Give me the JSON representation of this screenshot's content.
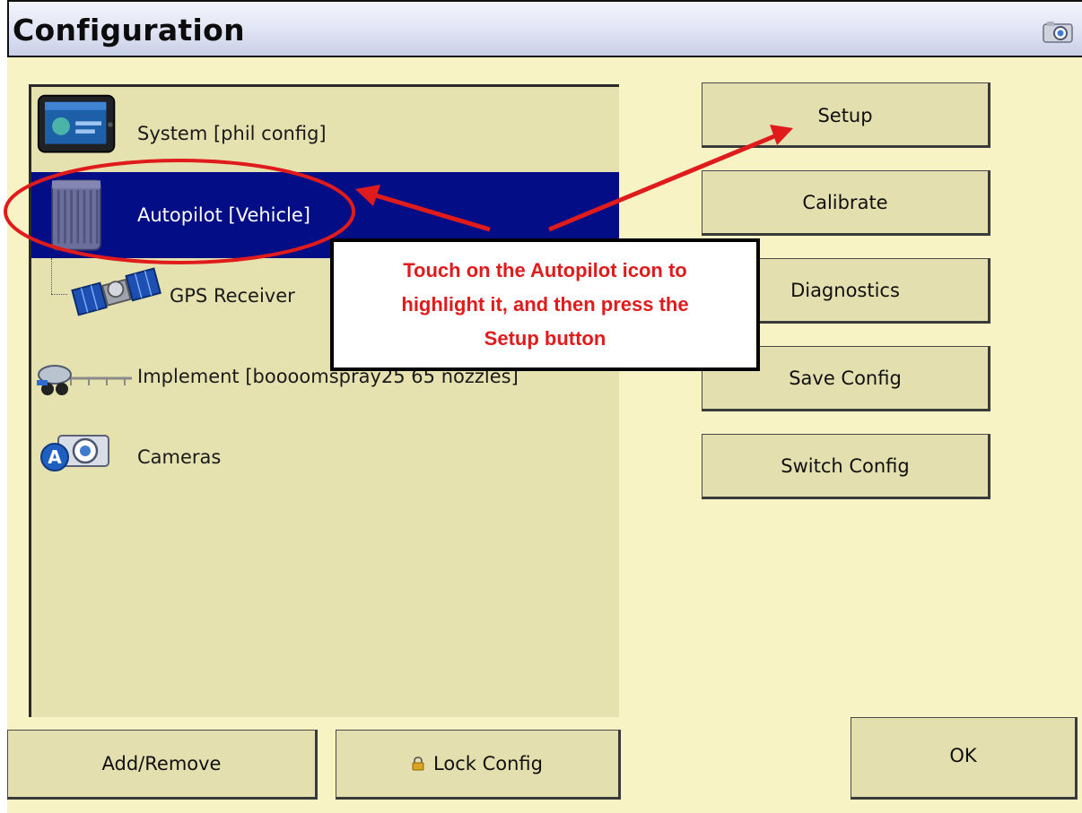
{
  "window": {
    "title": "Configuration",
    "title_icon": "camera-icon"
  },
  "tree": {
    "items": [
      {
        "label": "System [phil config]",
        "icon": "display-terminal-icon",
        "selected": false
      },
      {
        "label": "Autopilot [Vehicle]",
        "icon": "autopilot-controller-icon",
        "selected": true
      },
      {
        "label": "GPS Receiver",
        "icon": "satellite-icon",
        "selected": false
      },
      {
        "label": "Implement [boooomspray25 65 nozzles]",
        "icon": "sprayer-implement-icon",
        "selected": false
      },
      {
        "label": "Cameras",
        "icon": "camera-icon",
        "selected": false
      }
    ]
  },
  "buttons": {
    "setup": "Setup",
    "calibrate": "Calibrate",
    "diagnostics": "Diagnostics",
    "save_config": "Save Config",
    "switch_config": "Switch Config",
    "add_remove": "Add/Remove",
    "lock_config": "Lock Config",
    "lock_icon": "lock-icon",
    "ok": "OK"
  },
  "callout": {
    "line1": "Touch on the Autopilot icon to",
    "line2": "highlight it, and then press the",
    "line3": "Setup button"
  },
  "colors": {
    "background": "#f7f3c5",
    "panel": "#e6e2b0",
    "selection": "#020d86",
    "annotation": "#e01b1b"
  }
}
